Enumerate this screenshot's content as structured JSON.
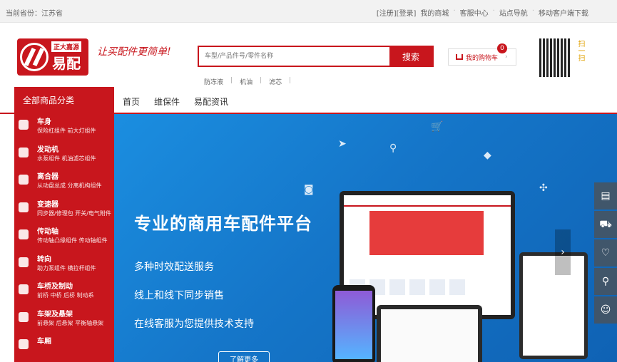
{
  "topbar": {
    "location": "当前省份：江苏省",
    "links": [
      "[注册][登录]",
      "我的商城",
      "客服中心",
      "站点导航",
      "移动客户端下载"
    ]
  },
  "brand": {
    "badge": "正大嘉源",
    "name": "易配",
    "slogan": "让买配件更简单!"
  },
  "search": {
    "placeholder": "车型/产品件号/零件名称",
    "button": "搜索",
    "hotwords": [
      "防冻液",
      "机油",
      "滤芯"
    ]
  },
  "cart": {
    "label": "我的购物车",
    "count": "0"
  },
  "qr_text": "扫一扫",
  "nav": {
    "category_title": "全部商品分类",
    "links": [
      "首页",
      "维保件",
      "易配资讯"
    ]
  },
  "categories": [
    {
      "name": "车身",
      "subs": "保险杠组件  前大灯组件"
    },
    {
      "name": "发动机",
      "subs": "水泵组件  机油滤芯组件"
    },
    {
      "name": "离合器",
      "subs": "从动盘总成  分离机构组件"
    },
    {
      "name": "变速器",
      "subs": "同步器/修理包  开关/电气附件"
    },
    {
      "name": "传动轴",
      "subs": "传动轴凸缘组件  传动轴组件"
    },
    {
      "name": "转向",
      "subs": "助力泵组件  横拉杆组件"
    },
    {
      "name": "车桥及制动",
      "subs": "前桥  中桥  后桥  制动系"
    },
    {
      "name": "车架及悬架",
      "subs": "前悬架  后悬架  平衡轴悬架"
    },
    {
      "name": "车厢",
      "subs": ""
    }
  ],
  "banner": {
    "headline": "专业的商用车配件平台",
    "lines": [
      "多种时效配送服务",
      "线上和线下同步销售",
      "在线客服为您提供技术支持"
    ],
    "more": "了解更多"
  }
}
